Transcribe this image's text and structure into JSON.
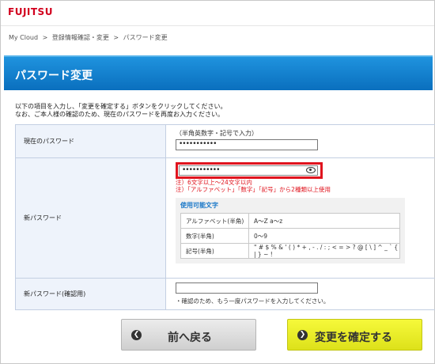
{
  "logo": "FUJITSU",
  "breadcrumb": [
    "My Cloud",
    ">",
    "登録情報確認・変更",
    ">",
    "パスワード変更"
  ],
  "page_title": "パスワード変更",
  "intro": [
    "以下の項目を入力し、「変更を確定する」ボタンをクリックしてください。",
    "なお、ご本人様の確認のため、現在のパスワードを再度お入力ください。"
  ],
  "current_password": {
    "label": "現在のパスワード",
    "hint": "（半角英数字・記号で入力）",
    "value": "•••••••••••"
  },
  "new_password": {
    "label": "新パスワード",
    "value": "•••••••••••",
    "notes": [
      "注）6文字以上～24文字以内",
      "注）「アルファベット」「数字」「記号」から2種類以上使用"
    ],
    "chars_title": "使用可能文字",
    "chars": [
      {
        "type": "アルファベット(半角)",
        "values": "A～Z a～z"
      },
      {
        "type": "数字(半角)",
        "values": "0～9"
      },
      {
        "type": "記号(半角)",
        "values": "\" # $ % & ' ( ) * + , - . / : ; < = > ? @ [ \\ ] ^ _ ` { | } ~ !"
      }
    ]
  },
  "confirm_password": {
    "label": "新パスワード(確認用)",
    "value": "",
    "hint": "・確認のため、もう一度パスワードを入力してください。"
  },
  "buttons": {
    "back": "前へ戻る",
    "back_icon": "❮",
    "confirm": "変更を確定する",
    "confirm_icon": "❯"
  },
  "colors": {
    "brand": "#d2001e",
    "title_bar": "#0a6fbe",
    "confirm_button": "#e6ea24",
    "highlight": "#e0141e"
  }
}
